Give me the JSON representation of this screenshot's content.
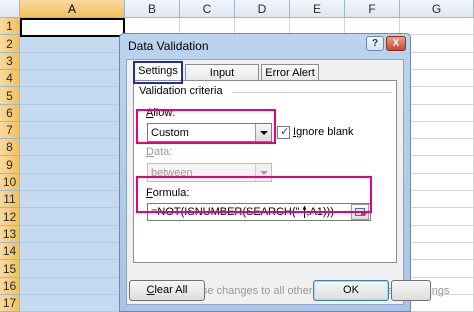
{
  "spreadsheet": {
    "columns": [
      "A",
      "B",
      "C",
      "D",
      "E",
      "F",
      "G"
    ],
    "selected_column": "A",
    "rows": [
      "1",
      "2",
      "3",
      "4",
      "5",
      "6",
      "7",
      "8",
      "9",
      "10",
      "11",
      "12",
      "13",
      "14",
      "15",
      "16",
      "17"
    ]
  },
  "dialog": {
    "title": "Data Validation",
    "help_glyph": "?",
    "close_glyph": "X",
    "tabs": [
      "Settings",
      "Input Message",
      "Error Alert"
    ],
    "active_tab": "Settings",
    "section_label": "Validation criteria",
    "allow": {
      "label_underlined": "A",
      "label_rest": "llow:",
      "value": "Custom"
    },
    "ignore_blank": {
      "label_underlined": "I",
      "label_rest": "gnore blank",
      "checked": true
    },
    "data": {
      "label_underlined": "D",
      "label_rest": "ata:",
      "value": "between"
    },
    "formula": {
      "label_underlined": "F",
      "label_rest": "ormula:",
      "value": "=NOT(ISNUMBER(SEARCH(\" \",A1)))"
    },
    "apply_all": {
      "label": "Apply these changes to all other cells with the same settings",
      "checked": false
    },
    "buttons": {
      "clear_all_underlined": "C",
      "clear_all_rest": "lear All",
      "ok": "OK",
      "cancel": "Cancel"
    }
  },
  "colors": {
    "highlight_magenta": "#e4007f",
    "highlight_blue": "#1c2fa8",
    "selection_fill": "#c5d9f1"
  }
}
